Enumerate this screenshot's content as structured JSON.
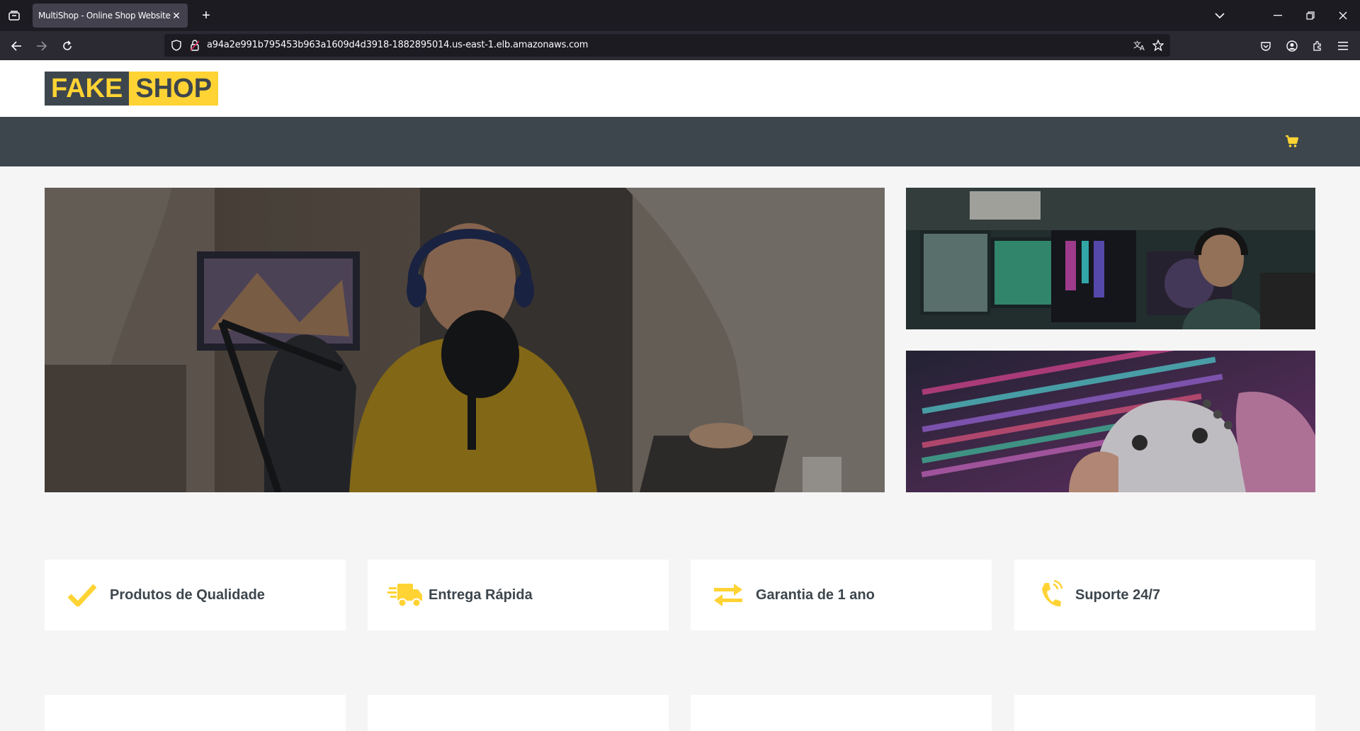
{
  "browser": {
    "tab_title": "MultiShop - Online Shop Website Te",
    "new_tab_label": "+",
    "close_tab_label": "✕",
    "url": "a94a2e991b795453b963a1609d4d3918-1882895014.us-east-1.elb.amazonaws.com"
  },
  "site": {
    "logo_part1": "FAKE",
    "logo_part2": "SHOP",
    "accent_color": "#ffd333",
    "dark_color": "#3d464d"
  },
  "carousel": {
    "slide_count": 3,
    "active_index": 2
  },
  "features": [
    {
      "icon": "check-icon",
      "label": "Produtos de Qualidade"
    },
    {
      "icon": "shipping-truck-icon",
      "label": "Entrega Rápida"
    },
    {
      "icon": "exchange-arrows-icon",
      "label": "Garantia de 1 ano"
    },
    {
      "icon": "phone-volume-icon",
      "label": "Suporte 24/7"
    }
  ]
}
